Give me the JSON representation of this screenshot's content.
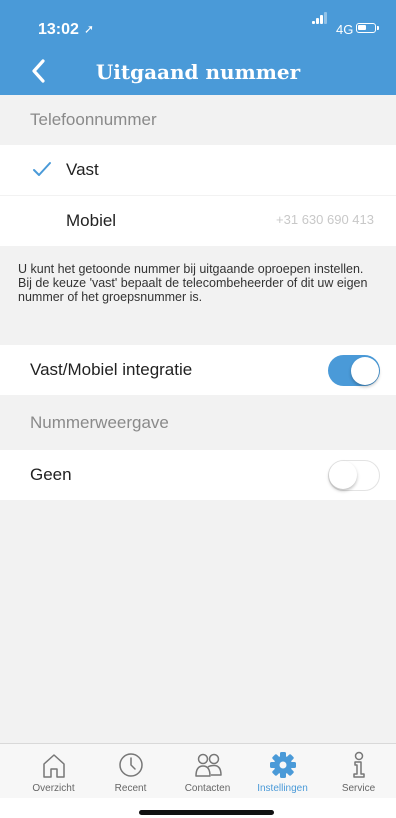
{
  "status": {
    "time": "13:02",
    "network": "4G",
    "battery_level": 0.55
  },
  "header": {
    "title": "Uitgaand nummer"
  },
  "sections": {
    "telefoonnummer": "Telefoonnummer",
    "nummerweergave": "Nummerweergave"
  },
  "options": {
    "vast": {
      "label": "Vast",
      "selected": true
    },
    "mobiel": {
      "label": "Mobiel",
      "value": "+31 630 690 413"
    }
  },
  "note": "U kunt het getoonde nummer bij uitgaande oproepen instellen. Bij de keuze 'vast' bepaalt de telecombeheerder of dit uw eigen nummer of het groepsnummer is.",
  "integration": {
    "label": "Vast/Mobiel integratie",
    "enabled": true
  },
  "geen": {
    "label": "Geen",
    "enabled": false
  },
  "colors": {
    "accent": "#4a9ad8",
    "background": "#f2f2f2"
  },
  "tabs": [
    {
      "label": "Overzicht",
      "icon": "home-icon",
      "active": false
    },
    {
      "label": "Recent",
      "icon": "clock-icon",
      "active": false
    },
    {
      "label": "Contacten",
      "icon": "contacts-icon",
      "active": false
    },
    {
      "label": "Instellingen",
      "icon": "gear-icon",
      "active": true
    },
    {
      "label": "Service",
      "icon": "info-icon",
      "active": false
    }
  ]
}
